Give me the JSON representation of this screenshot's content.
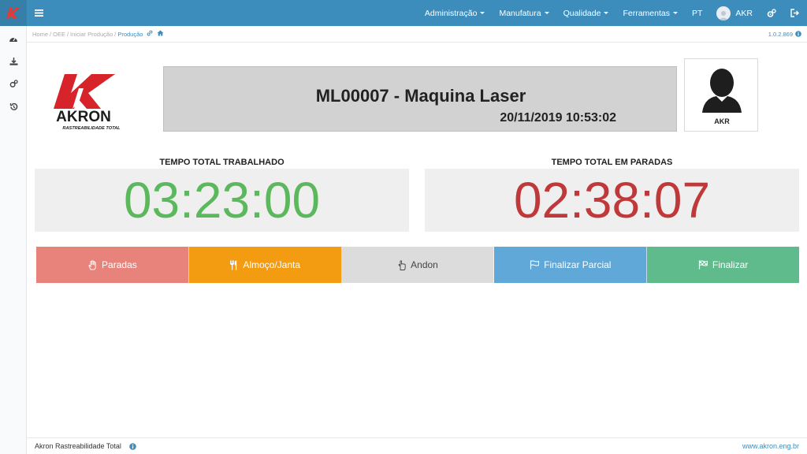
{
  "navbar": {
    "menus": [
      {
        "label": "Administração"
      },
      {
        "label": "Manufatura"
      },
      {
        "label": "Qualidade"
      },
      {
        "label": "Ferramentas"
      }
    ],
    "language": "PT",
    "user": "AKR"
  },
  "breadcrumb": {
    "items": [
      "Home",
      "OEE",
      "Iniciar Produção",
      "Produção"
    ],
    "version": "1.0.2.869"
  },
  "logo": {
    "name": "AKRON",
    "tagline": "RASTREABILIDADE TOTAL"
  },
  "machine": {
    "title": "ML00007 - Maquina Laser",
    "datetime": "20/11/2019 10:53:02"
  },
  "operator": {
    "name": "AKR"
  },
  "timers": {
    "worked_label": "TEMPO TOTAL TRABALHADO",
    "worked_value": "03:23:00",
    "stopped_label": "TEMPO TOTAL EM PARADAS",
    "stopped_value": "02:38:07"
  },
  "actions": {
    "paradas": "Paradas",
    "almoco": "Almoço/Janta",
    "andon": "Andon",
    "finalizar_parcial": "Finalizar Parcial",
    "finalizar": "Finalizar"
  },
  "footer": {
    "left": "Akron Rastreabilidade Total",
    "right": "www.akron.eng.br"
  },
  "colors": {
    "navbar": "#3c8dbc",
    "paradas": "#e8837b",
    "almoco": "#f39c12",
    "andon": "#dcdcdc",
    "finalizar_parcial": "#5fa8d8",
    "finalizar": "#5fbb8c",
    "timer_green": "#5cb85c",
    "timer_red": "#c0393a",
    "logo_red": "#d7232a"
  }
}
